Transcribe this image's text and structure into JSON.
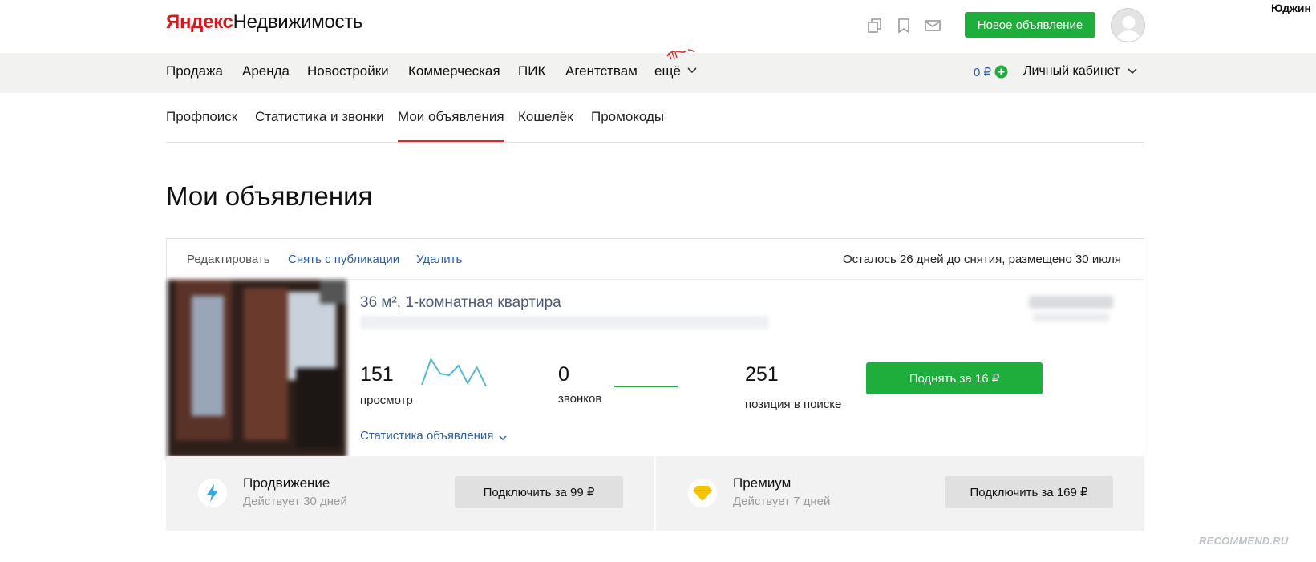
{
  "top_user": "Юджин",
  "header": {
    "logo_brand": "Яндекс",
    "logo_product": "Недвижимость",
    "new_listing_button": "Новое объявление",
    "icons": [
      "compare-icon",
      "bookmark-icon",
      "mail-icon"
    ]
  },
  "main_nav": {
    "items": [
      "Продажа",
      "Аренда",
      "Новостройки",
      "Коммерческая",
      "ПИК",
      "Агентствам",
      "ещё"
    ],
    "balance": "0 ₽",
    "cabinet": "Личный кабинет"
  },
  "sub_nav": {
    "tabs": [
      "Профпоиск",
      "Статистика и звонки",
      "Мои объявления",
      "Кошелёк",
      "Промокоды"
    ],
    "active_tab": "Мои объявления"
  },
  "page_title": "Мои объявления",
  "listing": {
    "actions": {
      "edit": "Редактировать",
      "unpublish": "Снять с публикации",
      "delete": "Удалить"
    },
    "days_left": "Осталось 26 дней до снятия, размещено 30 июля",
    "title": "36 м², 1-комнатная квартира",
    "stats": {
      "views_value": "151",
      "views_label": "просмотр",
      "views_trend": [
        2,
        18,
        9,
        8,
        14,
        3,
        13,
        1
      ],
      "calls_value": "0",
      "calls_label": "звонков",
      "calls_trend": [
        0,
        0,
        0,
        0,
        0,
        0,
        0,
        0
      ],
      "position_value": "251",
      "position_label": "позиция в поиске",
      "position_trend": "down"
    },
    "raise_button": "Поднять за 16 ₽",
    "stats_link": "Статистика объявления"
  },
  "promotions": [
    {
      "title": "Продвижение",
      "subtitle": "Действует 30 дней",
      "button": "Подключить за 99 ₽",
      "icon": "lightning-icon"
    },
    {
      "title": "Премиум",
      "subtitle": "Действует 7 дней",
      "button": "Подключить за 169 ₽",
      "icon": "diamond-icon"
    }
  ],
  "colors": {
    "accent_green": "#1fad3c",
    "link_blue": "#2b5ca8",
    "active_tab_red": "#d42a2a",
    "sparkline_teal": "#57b9d0"
  },
  "watermark": "RECOMMEND.RU"
}
